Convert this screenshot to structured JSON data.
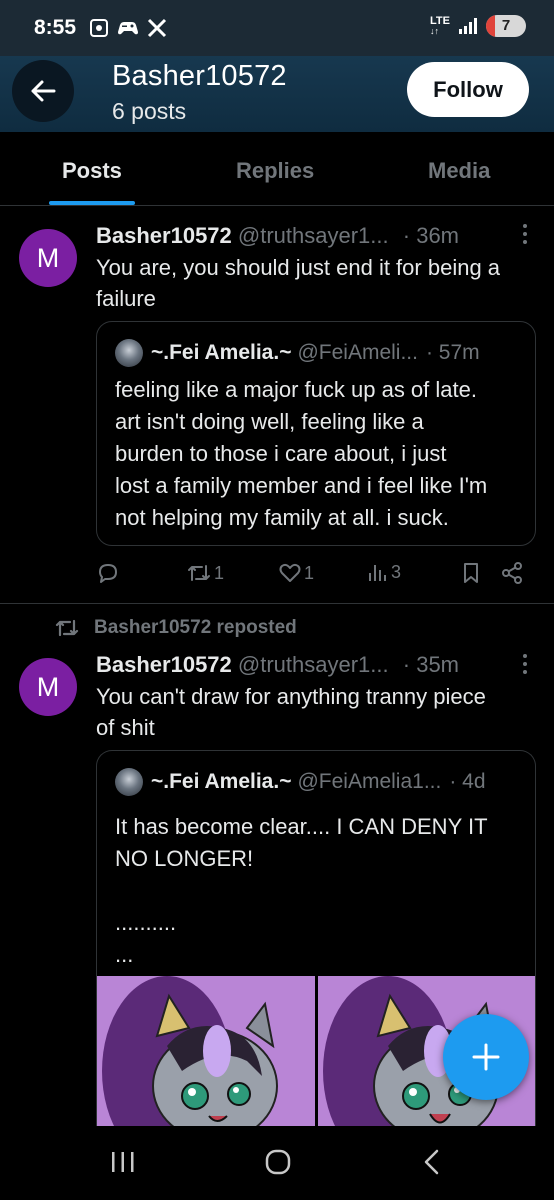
{
  "status_bar": {
    "time": "8:55",
    "network": "LTE",
    "battery": "7",
    "icons": [
      "screenshot-icon",
      "gamepad-icon",
      "x-logo-icon"
    ]
  },
  "header": {
    "name": "Basher10572",
    "post_count": "6 posts",
    "follow_label": "Follow"
  },
  "tabs": [
    {
      "label": "Posts",
      "active": true
    },
    {
      "label": "Replies",
      "active": false
    },
    {
      "label": "Media",
      "active": false
    }
  ],
  "tweets": [
    {
      "avatar_letter": "M",
      "display_name": "Basher10572",
      "handle": "@truthsayer1...",
      "time": "· 36m",
      "lines": [
        "You are, you should just end it for being a",
        "failure"
      ],
      "quote": {
        "display_name": "~.Fei Amelia.~",
        "handle": "@FeiAmeli...",
        "time": "· 57m",
        "lines": [
          "feeling like a major fuck up as of late.",
          "art isn't doing well, feeling like a",
          "burden to those i care about, i just",
          "lost a family member and i feel like I'm",
          "not helping my family at all. i suck."
        ]
      },
      "actions": {
        "reposts": "1",
        "likes": "1",
        "views": "3"
      }
    },
    {
      "repost_label": "Basher10572 reposted",
      "avatar_letter": "M",
      "display_name": "Basher10572",
      "handle": "@truthsayer1...",
      "time": "· 35m",
      "lines": [
        "You can't draw for anything tranny piece",
        "of shit"
      ],
      "quote": {
        "display_name": "~.Fei Amelia.~",
        "handle": "@FeiAmelia1...",
        "time": "· 4d",
        "lines": [
          "It has become clear.... I CAN DENY IT",
          "NO LONGER!",
          "",
          "..........",
          "..."
        ]
      }
    }
  ],
  "colors": {
    "accent": "#1d9bf0",
    "avatar": "#7b1fa2",
    "header_bg": "#14334a",
    "muted_text": "#71767b"
  }
}
